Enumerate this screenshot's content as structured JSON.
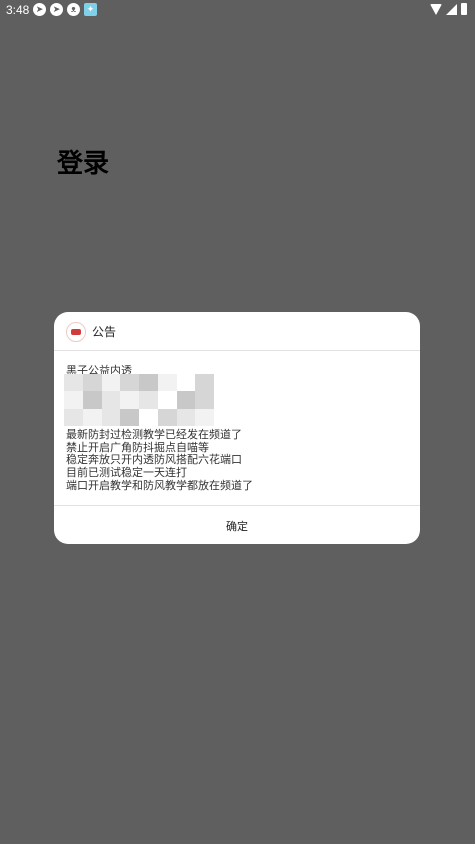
{
  "status_bar": {
    "time": "3:48",
    "left_icons": [
      "telegram-icon",
      "telegram-icon",
      "cat-icon",
      "app-icon"
    ],
    "right_icons": [
      "wifi-icon",
      "signal-icon",
      "battery-icon"
    ]
  },
  "page": {
    "title": "登录"
  },
  "dialog": {
    "title": "公告",
    "body_lines": [
      "黑子公益内透",
      "最新防封过检测教学已经发在频道了",
      "禁止开启广角防抖掘点自喵等",
      "稳定奔放只开内透防风搭配六花端口",
      "目前已测试稳定一天连打",
      "端口开启教学和防风教学都放在频道了"
    ],
    "confirm_label": "确定"
  },
  "colors": {
    "backdrop": "#5f5f5f",
    "dialog_bg": "#ffffff",
    "divider": "#e2e2e2",
    "logo_accent": "#d23b3b"
  }
}
